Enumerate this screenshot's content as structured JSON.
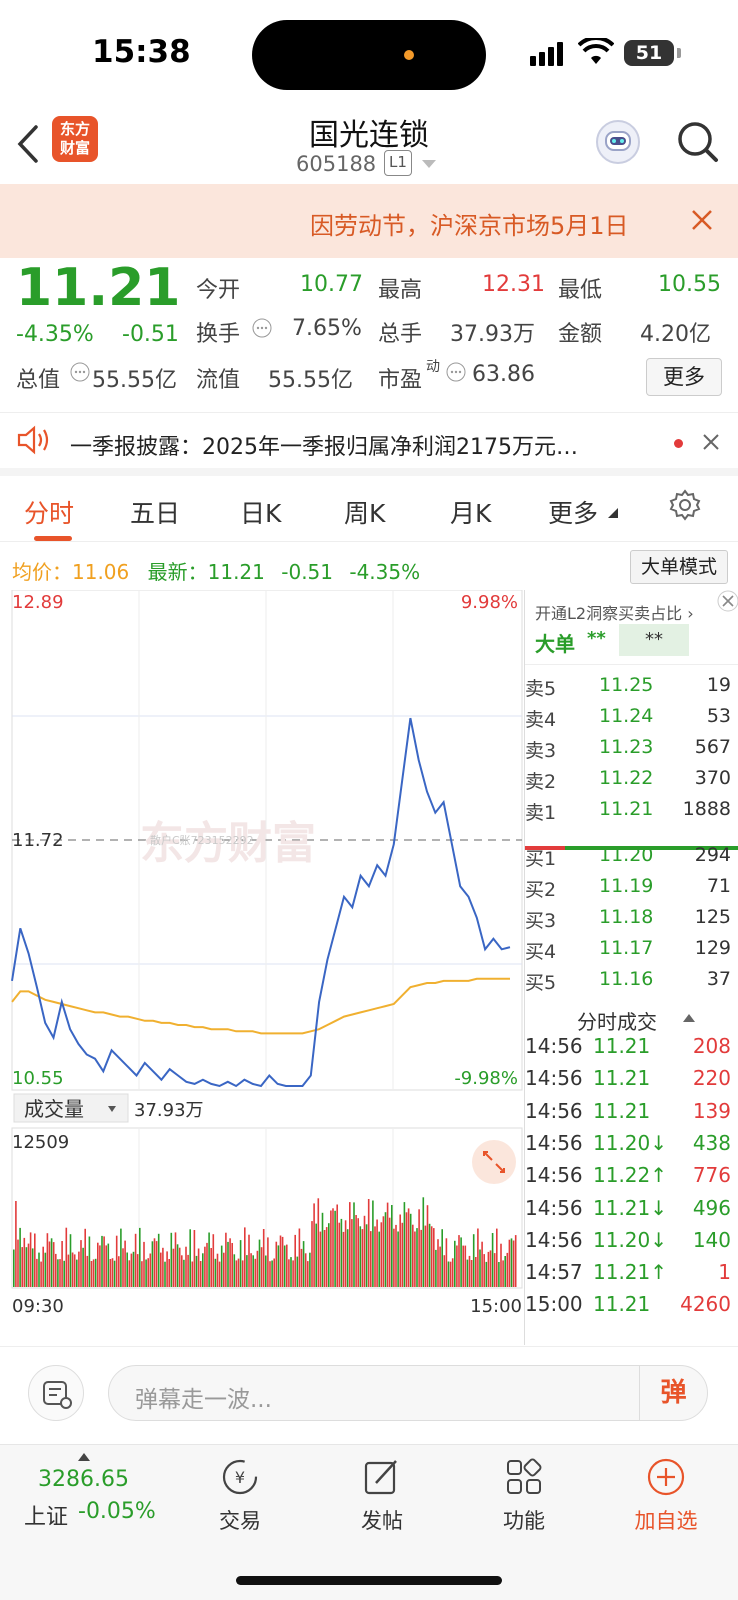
{
  "status_bar": {
    "time": "15:38",
    "battery": "51"
  },
  "header": {
    "logo_text": "东方\n财富",
    "title": "国光连锁",
    "code": "605188",
    "level": "L1"
  },
  "notice": {
    "text": "因劳动节，沪深京市场5月1日"
  },
  "quote": {
    "price": "11.21",
    "change_pct": "-4.35%",
    "change_abs": "-0.51",
    "open_label": "今开",
    "open": "10.77",
    "high_label": "最高",
    "high": "12.31",
    "low_label": "最低",
    "low": "10.55",
    "turnover_label": "换手",
    "turnover": "7.65%",
    "volume_label": "总手",
    "volume": "37.93万",
    "amount_label": "金额",
    "amount": "4.20亿",
    "mktcap_label": "总值",
    "mktcap": "55.55亿",
    "float_label": "流值",
    "float": "55.55亿",
    "pe_label": "市盈",
    "pe_sup": "动",
    "pe": "63.86",
    "more": "更多"
  },
  "news": {
    "text": "一季报披露：2025年一季报归属净利润2175万元…"
  },
  "tabs": [
    "分时",
    "五日",
    "日K",
    "周K",
    "月K",
    "更多"
  ],
  "avg_bar": {
    "avg_label": "均价：",
    "avg": "11.06",
    "latest_label": "最新：",
    "latest": "11.21",
    "chg": "-0.51",
    "pct": "-4.35%",
    "mode_btn": "大单模式"
  },
  "chart_data": {
    "type": "line",
    "price_axis": {
      "top": "12.89",
      "mid": "11.72",
      "bottom": "10.55",
      "top_pct": "9.98%",
      "bottom_pct": "-9.98%",
      "ylim": [
        10.55,
        12.89
      ]
    },
    "watermark": "东方财富",
    "watermark_id": "散户C账723152292",
    "series": [
      {
        "color": "#3a66c4",
        "values": [
          11.05,
          11.3,
          11.18,
          11.02,
          10.85,
          10.78,
          10.95,
          10.82,
          10.75,
          10.7,
          10.68,
          10.62,
          10.72,
          10.68,
          10.64,
          10.6,
          10.66,
          10.62,
          10.58,
          10.63,
          10.6,
          10.57,
          10.56,
          10.58,
          10.56,
          10.55,
          10.57,
          10.55,
          10.58,
          10.56,
          10.55,
          10.6,
          10.56,
          10.55,
          10.55,
          10.55,
          10.6,
          10.95,
          11.15,
          11.3,
          11.45,
          11.4,
          11.55,
          11.5,
          11.6,
          11.55,
          11.7,
          12.0,
          12.3,
          12.1,
          11.95,
          11.85,
          11.9,
          11.7,
          11.5,
          11.45,
          11.35,
          11.2,
          11.25,
          11.2,
          11.21
        ]
      },
      {
        "color": "#f0b030",
        "values": [
          10.95,
          11.0,
          11.0,
          10.98,
          10.96,
          10.95,
          10.94,
          10.93,
          10.92,
          10.91,
          10.9,
          10.9,
          10.89,
          10.88,
          10.88,
          10.87,
          10.86,
          10.86,
          10.85,
          10.85,
          10.84,
          10.84,
          10.83,
          10.83,
          10.82,
          10.82,
          10.82,
          10.81,
          10.81,
          10.81,
          10.8,
          10.8,
          10.8,
          10.8,
          10.8,
          10.8,
          10.81,
          10.82,
          10.84,
          10.86,
          10.88,
          10.89,
          10.9,
          10.91,
          10.92,
          10.93,
          10.94,
          10.98,
          11.02,
          11.03,
          11.04,
          11.04,
          11.05,
          11.05,
          11.05,
          11.05,
          11.06,
          11.06,
          11.06,
          11.06,
          11.06
        ]
      }
    ],
    "volume_label": "成交量",
    "volume_total": "37.93万",
    "volume_max": "12509",
    "time_start": "09:30",
    "time_end": "15:00"
  },
  "order_book": {
    "promo": "开通L2洞察买卖占比",
    "big_label": "大单",
    "big_val1": "**",
    "big_val2": "**",
    "asks": [
      {
        "label": "卖5",
        "price": "11.25",
        "qty": "19"
      },
      {
        "label": "卖4",
        "price": "11.24",
        "qty": "53"
      },
      {
        "label": "卖3",
        "price": "11.23",
        "qty": "567"
      },
      {
        "label": "卖2",
        "price": "11.22",
        "qty": "370"
      },
      {
        "label": "卖1",
        "price": "11.21",
        "qty": "1888"
      }
    ],
    "bids": [
      {
        "label": "买1",
        "price": "11.20",
        "qty": "294"
      },
      {
        "label": "买2",
        "price": "11.19",
        "qty": "71"
      },
      {
        "label": "买3",
        "price": "11.18",
        "qty": "125"
      },
      {
        "label": "买4",
        "price": "11.17",
        "qty": "129"
      },
      {
        "label": "买5",
        "price": "11.16",
        "qty": "37"
      }
    ],
    "trades_title": "分时成交",
    "trades": [
      {
        "time": "14:56",
        "price": "11.21",
        "qty": "208"
      },
      {
        "time": "14:56",
        "price": "11.21",
        "qty": "220"
      },
      {
        "time": "14:56",
        "price": "11.21",
        "qty": "139"
      },
      {
        "time": "14:56",
        "price": "11.20↓",
        "qty": "438"
      },
      {
        "time": "14:56",
        "price": "11.22↑",
        "qty": "776"
      },
      {
        "time": "14:56",
        "price": "11.21↓",
        "qty": "496"
      },
      {
        "time": "14:56",
        "price": "11.20↓",
        "qty": "140"
      },
      {
        "time": "14:57",
        "price": "11.21↑",
        "qty": "1"
      },
      {
        "time": "15:00",
        "price": "11.21",
        "qty": "4260"
      }
    ]
  },
  "input_bar": {
    "placeholder": "弹幕走一波...",
    "dan": "弹"
  },
  "bottom_nav": {
    "index_value": "3286.65",
    "index_name": "上证",
    "index_chg": "-0.05%",
    "trade": "交易",
    "post": "发帖",
    "func": "功能",
    "add": "加自选"
  }
}
